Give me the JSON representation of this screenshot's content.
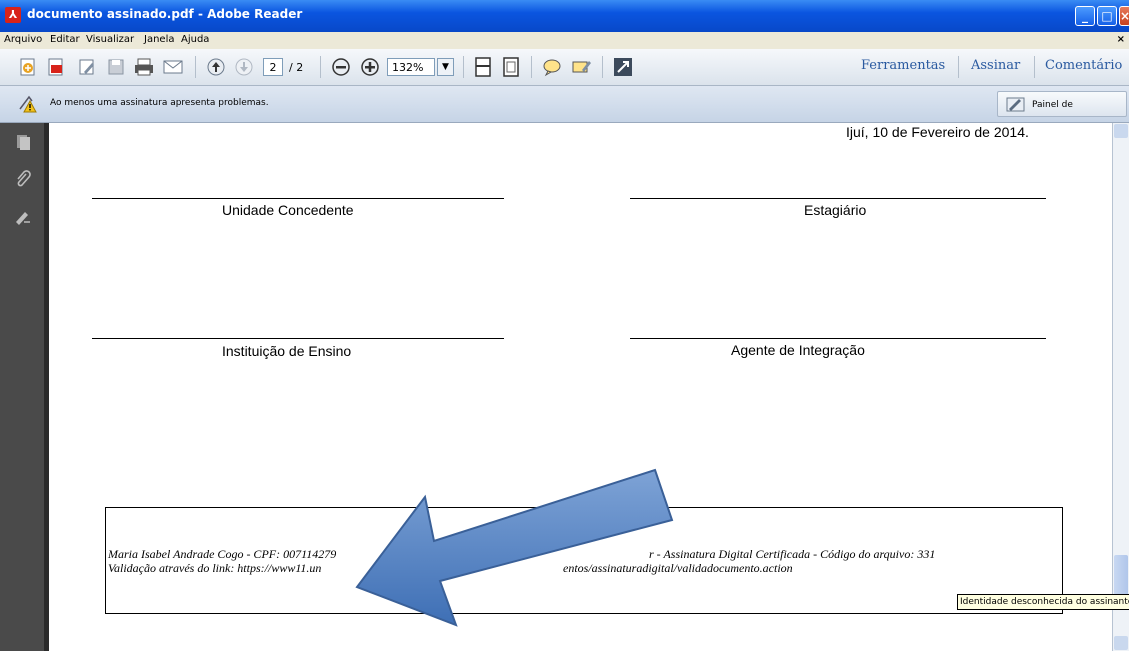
{
  "window": {
    "title": "documento assinado.pdf - Adobe Reader"
  },
  "menu": {
    "items": [
      "Arquivo",
      "Editar",
      "Visualizar",
      "Janela",
      "Ajuda"
    ],
    "close": "×"
  },
  "toolbar": {
    "current_page": "2",
    "total_pages": "/ 2",
    "zoom": "132%",
    "right_tabs": [
      "Ferramentas",
      "Assinar",
      "Comentário"
    ]
  },
  "notification": {
    "message": "Ao menos uma assinatura apresenta problemas.",
    "panel_button": "Painel de assinaturas"
  },
  "document": {
    "date_line": "Ijuí, 10 de Fevereiro de 2014.",
    "signatures": {
      "unidade": "Unidade Concedente",
      "estagiario": "Estagiário",
      "instituicao": "Instituição de Ensino",
      "agente": "Agente de Integração"
    },
    "stamp": {
      "line1_left": "Maria Isabel Andrade Cogo - CPF: 007114279",
      "line1_right": "r - Assinatura Digital Certificada - Código do arquivo: 331",
      "line2_left": "Validação através do link: https://www11.un",
      "line2_right": "entos/assinaturadigital/validadocumento.action"
    }
  },
  "tooltip": "Identidade desconhecida do assinante",
  "colors": {
    "titlebar": "#0a55e0",
    "arrow": "#4f81bd",
    "left_nav": "#4a4a4a",
    "tab_text": "#2a5aa0"
  }
}
